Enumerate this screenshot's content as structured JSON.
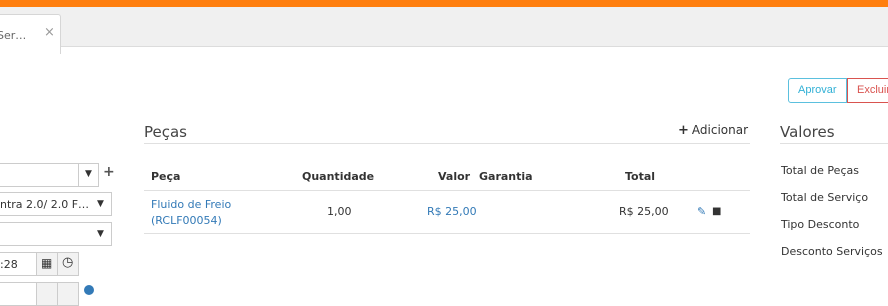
{
  "window": {
    "accent_color": "#ff7f0f"
  },
  "tab": {
    "label": "Ser…",
    "close_symbol": "×"
  },
  "actions": {
    "approve_label": "Aprovar",
    "delete_label": "Excluir"
  },
  "left_form": {
    "select_1_value": "",
    "select_2_value": "ntra 2.0/ 2.0 F…",
    "select_3_value": "",
    "time_1_value": ":28",
    "add_symbol": "+"
  },
  "parts": {
    "title": "Peças",
    "add_label": "Adicionar",
    "columns": [
      "Peça",
      "Quantidade",
      "Valor",
      "Garantia",
      "Total"
    ],
    "rows": [
      {
        "name_line1": "Fluido de Freio",
        "name_line2": "(RCLF00054)",
        "quantity": "1,00",
        "value": "R$ 25,00",
        "warranty": "",
        "total": "R$ 25,00"
      }
    ]
  },
  "values": {
    "title": "Valores",
    "labels": [
      "Total de Peças",
      "Total de Serviço",
      "Tipo Desconto",
      "Desconto Serviços"
    ]
  },
  "colors": {
    "link": "#337ab7",
    "approve": "#31b0d5",
    "delete": "#d9534f"
  }
}
